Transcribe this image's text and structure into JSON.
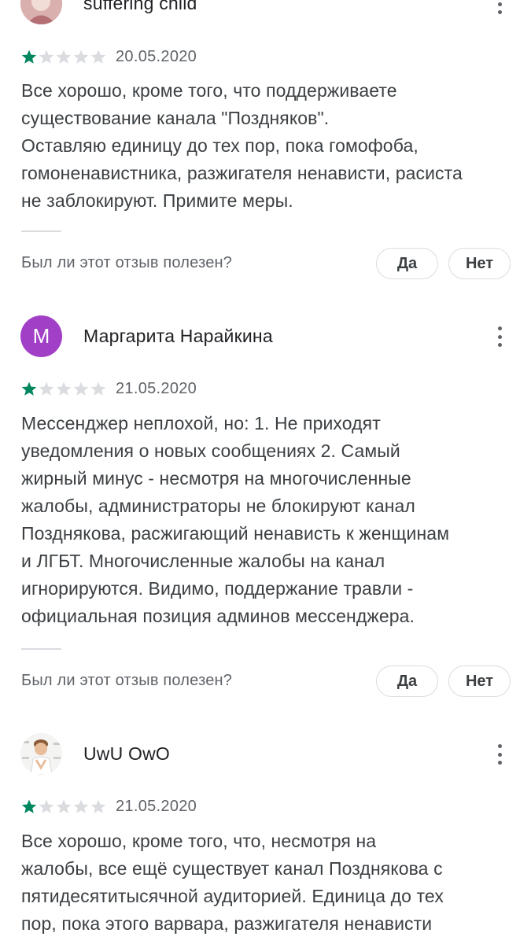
{
  "accent_star": "#01875f",
  "empty_star": "#dadce0",
  "helpful_question": "Был ли этот отзыв полезен?",
  "yes_label": "Да",
  "no_label": "Нет",
  "reviews": [
    {
      "author": "suffering child",
      "rating": 1,
      "date": "20.05.2020",
      "text_lines": [
        "Все хорошо, кроме того, что поддерживаете",
        "существование канала \"Поздняков\".",
        "Оставляю единицу до тех пор, пока гомофоба,",
        "гомоненавистника, разжигателя ненависти, расиста",
        "не заблокируют. Примите меры."
      ]
    },
    {
      "author": "Маргарита Нарайкина",
      "avatar_letter": "М",
      "avatar_color": "#a23fc7",
      "rating": 1,
      "date": "21.05.2020",
      "text_lines": [
        "Мессенджер неплохой, но: 1. Не приходят",
        "уведомления о новых сообщениях 2. Самый",
        "жирный минус - несмотря на многочисленные",
        "жалобы, администраторы не блокируют канал",
        "Позднякова, расжигающий ненависть к женщинам",
        "и ЛГБТ. Многочисленные жалобы на канал",
        "игнорируются. Видимо, поддержание травли -",
        "официальная позиция админов мессенджера."
      ]
    },
    {
      "author": "UwU OwO",
      "rating": 1,
      "date": "21.05.2020",
      "text_lines": [
        "Все хорошо, кроме того, что, несмотря на",
        "жалобы, все ещё существует канал Позднякова с",
        "пятидесятитысячной аудиторией. Единица до тех",
        "пор, пока этого варвара, разжигателя ненависти"
      ]
    }
  ]
}
